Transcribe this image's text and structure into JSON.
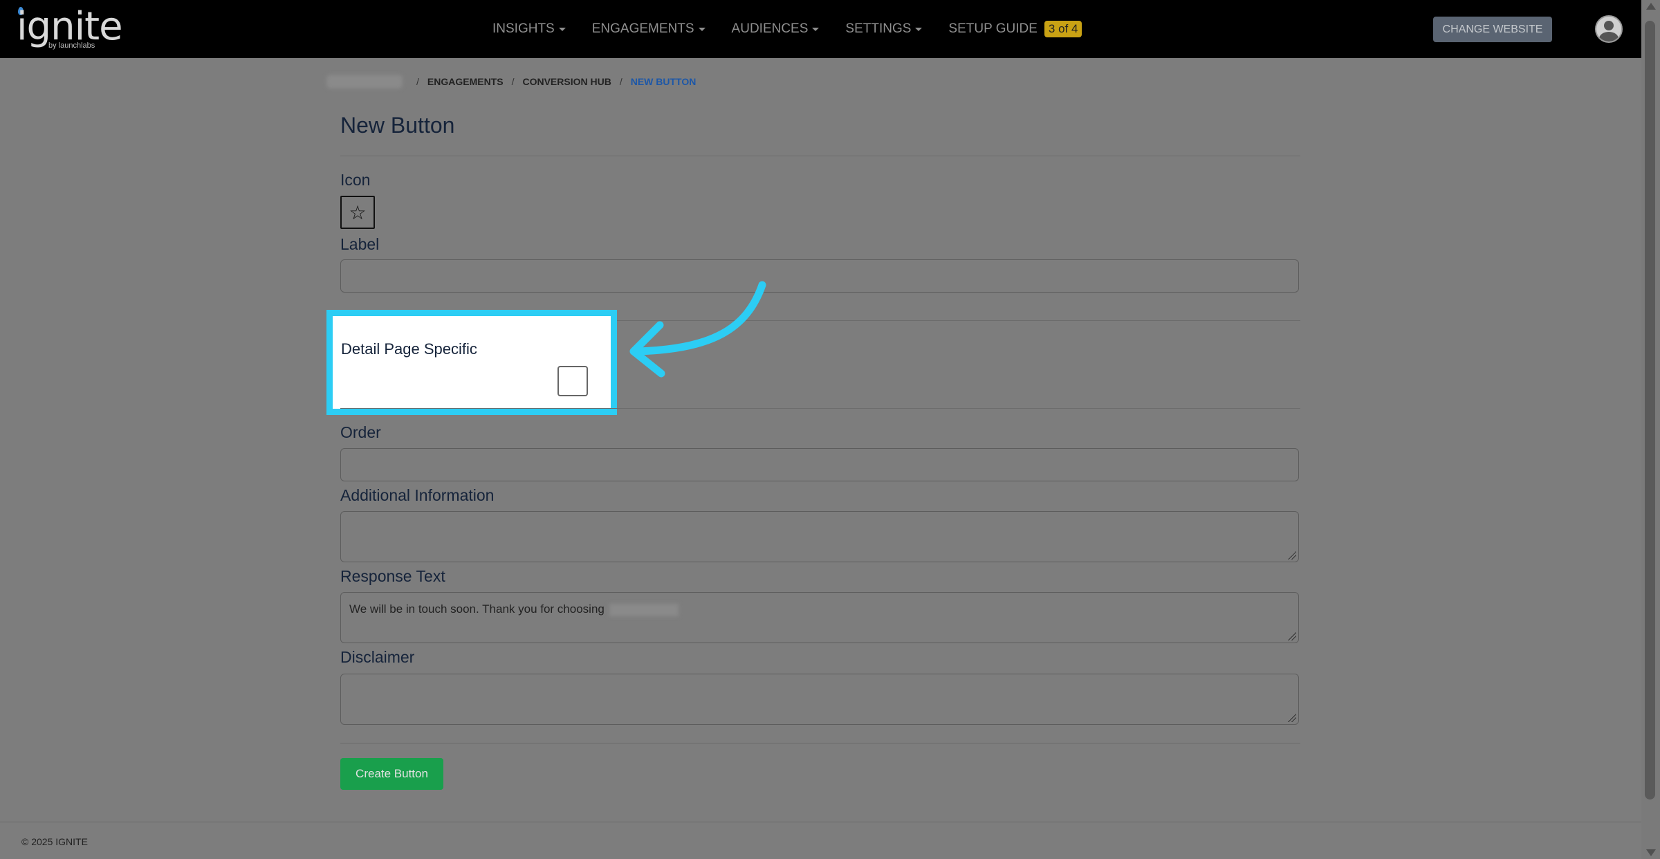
{
  "nav": {
    "logo_text": "ignite",
    "logo_sub": "by launchlabs",
    "items": [
      {
        "label": "INSIGHTS"
      },
      {
        "label": "ENGAGEMENTS"
      },
      {
        "label": "AUDIENCES"
      },
      {
        "label": "SETTINGS"
      }
    ],
    "setup_guide": {
      "label": "SETUP GUIDE",
      "badge": "3 of 4"
    },
    "change_website": "CHANGE WEBSITE"
  },
  "breadcrumb": {
    "items": [
      {
        "label": "ENGAGEMENTS"
      },
      {
        "label": "CONVERSION HUB"
      },
      {
        "label": "NEW BUTTON"
      }
    ],
    "separator": "/"
  },
  "page": {
    "title": "New Button",
    "icon_label": "Icon",
    "icon_glyph": "☆",
    "label_label": "Label",
    "label_value": "",
    "detail_page_specific": "Detail Page Specific",
    "detail_page_specific_checked": false,
    "order_label": "Order",
    "order_value": "",
    "additional_info_label": "Additional Information",
    "additional_info_value": "",
    "response_text_label": "Response Text",
    "response_text_value": "We will be in touch soon. Thank you for choosing",
    "disclaimer_label": "Disclaimer",
    "disclaimer_value": "",
    "create_button": "Create Button"
  },
  "colors": {
    "highlight": "#2ccdf4",
    "primary_button": "#199f4c",
    "active_crumb": "#1c57a8",
    "badge": "#c9a214"
  },
  "footer": {
    "text": "© 2025 IGNITE"
  }
}
